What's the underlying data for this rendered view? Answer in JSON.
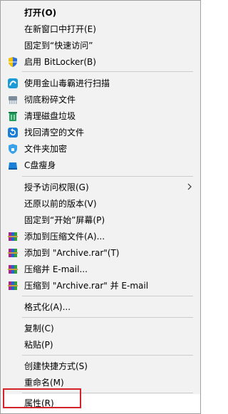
{
  "menu": {
    "open": "打开(O)",
    "open_new_window": "在新窗口中打开(E)",
    "pin_quick_access": "固定到“快速访问”",
    "bitlocker": "启用 BitLocker(B)",
    "kingsoft_scan": "使用金山毒霸进行扫描",
    "shred": "彻底粉碎文件",
    "clean_disk": "清理磁盘垃圾",
    "recover_files": "找回清空的文件",
    "encrypt_folder": "文件夹加密",
    "c_slim": "C盘瘦身",
    "grant_access": "授予访问权限(G)",
    "restore_versions": "还原以前的版本(V)",
    "pin_start": "固定到“开始”屏幕(P)",
    "add_archive": "添加到压缩文件(A)...",
    "add_archive_rar": "添加到 \"Archive.rar\"(T)",
    "compress_email": "压缩并 E-mail...",
    "compress_rar_email": "压缩到 \"Archive.rar\" 并 E-mail",
    "format": "格式化(A)...",
    "copy": "复制(C)",
    "paste": "粘贴(P)",
    "create_shortcut": "创建快捷方式(S)",
    "rename": "重命名(M)",
    "properties": "属性(R)"
  },
  "colors": {
    "menu_bg": "#f2f2f2",
    "highlight_border": "#d3222a"
  }
}
